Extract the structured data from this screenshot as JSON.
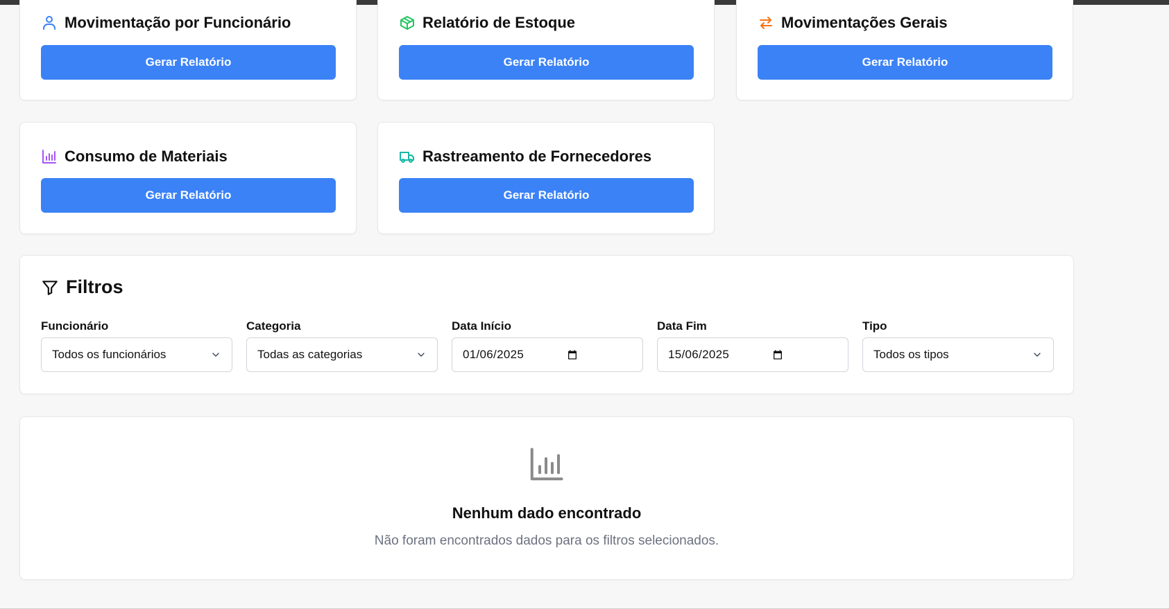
{
  "reports": [
    {
      "title": "Movimentação por Funcionário",
      "icon": "user-icon",
      "icon_color": "#3b82f6",
      "button": "Gerar Relatório"
    },
    {
      "title": "Relatório de Estoque",
      "icon": "package-icon",
      "icon_color": "#22c55e",
      "button": "Gerar Relatório"
    },
    {
      "title": "Movimentações Gerais",
      "icon": "arrows-exchange-icon",
      "icon_color": "#f97316",
      "button": "Gerar Relatório"
    },
    {
      "title": "Consumo de Materiais",
      "icon": "bar-chart-icon",
      "icon_color": "#a855f7",
      "button": "Gerar Relatório"
    },
    {
      "title": "Rastreamento de Fornecedores",
      "icon": "truck-icon",
      "icon_color": "#14b8a6",
      "button": "Gerar Relatório"
    }
  ],
  "filters": {
    "title": "Filtros",
    "icon": "filter-icon",
    "fields": [
      {
        "label": "Funcionário",
        "value": "Todos os funcionários",
        "type": "select"
      },
      {
        "label": "Categoria",
        "value": "Todas as categorias",
        "type": "select"
      },
      {
        "label": "Data Início",
        "value": "01/06/2025",
        "type": "date"
      },
      {
        "label": "Data Fim",
        "value": "15/06/2025",
        "type": "date"
      },
      {
        "label": "Tipo",
        "value": "Todos os tipos",
        "type": "select"
      }
    ]
  },
  "empty_state": {
    "icon": "bar-chart-icon",
    "title": "Nenhum dado encontrado",
    "description": "Não foram encontrados dados para os filtros selecionados."
  },
  "colors": {
    "primary": "#3b82f6",
    "background": "#f7f7f7",
    "muted_text": "#6b7280"
  }
}
